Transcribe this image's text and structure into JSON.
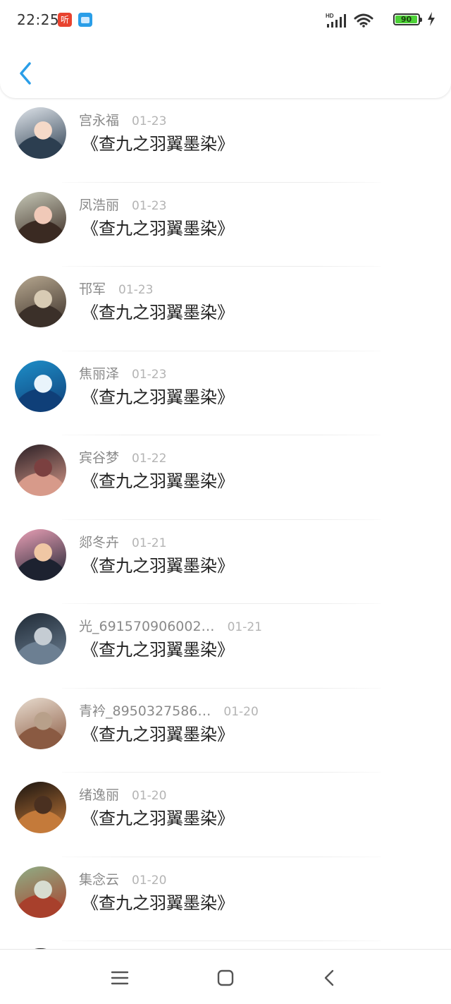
{
  "status_bar": {
    "time": "22:25",
    "notif_app_1": "听",
    "battery": "90"
  },
  "items": [
    {
      "name": "宫永福",
      "date": "01-23",
      "title": "《查九之羽翼墨染》",
      "avatar_colors": [
        "#dfe4ea",
        "#2c3e50",
        "#f5d9c8"
      ]
    },
    {
      "name": "凤浩丽",
      "date": "01-23",
      "title": "《查九之羽翼墨染》",
      "avatar_colors": [
        "#c7c9b8",
        "#3a2a22",
        "#f0c9b8"
      ]
    },
    {
      "name": "邗军",
      "date": "01-23",
      "title": "《查九之羽翼墨染》",
      "avatar_colors": [
        "#b7a890",
        "#3b3029",
        "#d8cbb4"
      ]
    },
    {
      "name": "焦丽泽",
      "date": "01-23",
      "title": "《查九之羽翼墨染》",
      "avatar_colors": [
        "#1e8fc9",
        "#0f3f78",
        "#e9f4fb"
      ]
    },
    {
      "name": "宾谷梦",
      "date": "01-22",
      "title": "《查九之羽翼墨染》",
      "avatar_colors": [
        "#2b1f25",
        "#d79a8a",
        "#7b4040"
      ]
    },
    {
      "name": "郯冬卉",
      "date": "01-21",
      "title": "《查九之羽翼墨染》",
      "avatar_colors": [
        "#e9a0b6",
        "#1d2230",
        "#f0c7a4"
      ]
    },
    {
      "name": "光_691570906002…",
      "date": "01-21",
      "title": "《查九之羽翼墨染》",
      "avatar_colors": [
        "#1f2a36",
        "#6c7f92",
        "#c5ccd3"
      ]
    },
    {
      "name": "青衿_8950327586…",
      "date": "01-20",
      "title": "《查九之羽翼墨染》",
      "avatar_colors": [
        "#e8dccf",
        "#8a5a42",
        "#b8a08a"
      ]
    },
    {
      "name": "绪逸丽",
      "date": "01-20",
      "title": "《查九之羽翼墨染》",
      "avatar_colors": [
        "#1a1410",
        "#c47a3a",
        "#4a3020"
      ]
    },
    {
      "name": "集念云",
      "date": "01-20",
      "title": "《查九之羽翼墨染》",
      "avatar_colors": [
        "#8fae86",
        "#a8402c",
        "#d7ddd0"
      ]
    }
  ],
  "colors": {
    "accent": "#2a9ee8",
    "name_gray": "#8a8a8a",
    "date_gray": "#b4b4b4",
    "title": "#222222"
  }
}
